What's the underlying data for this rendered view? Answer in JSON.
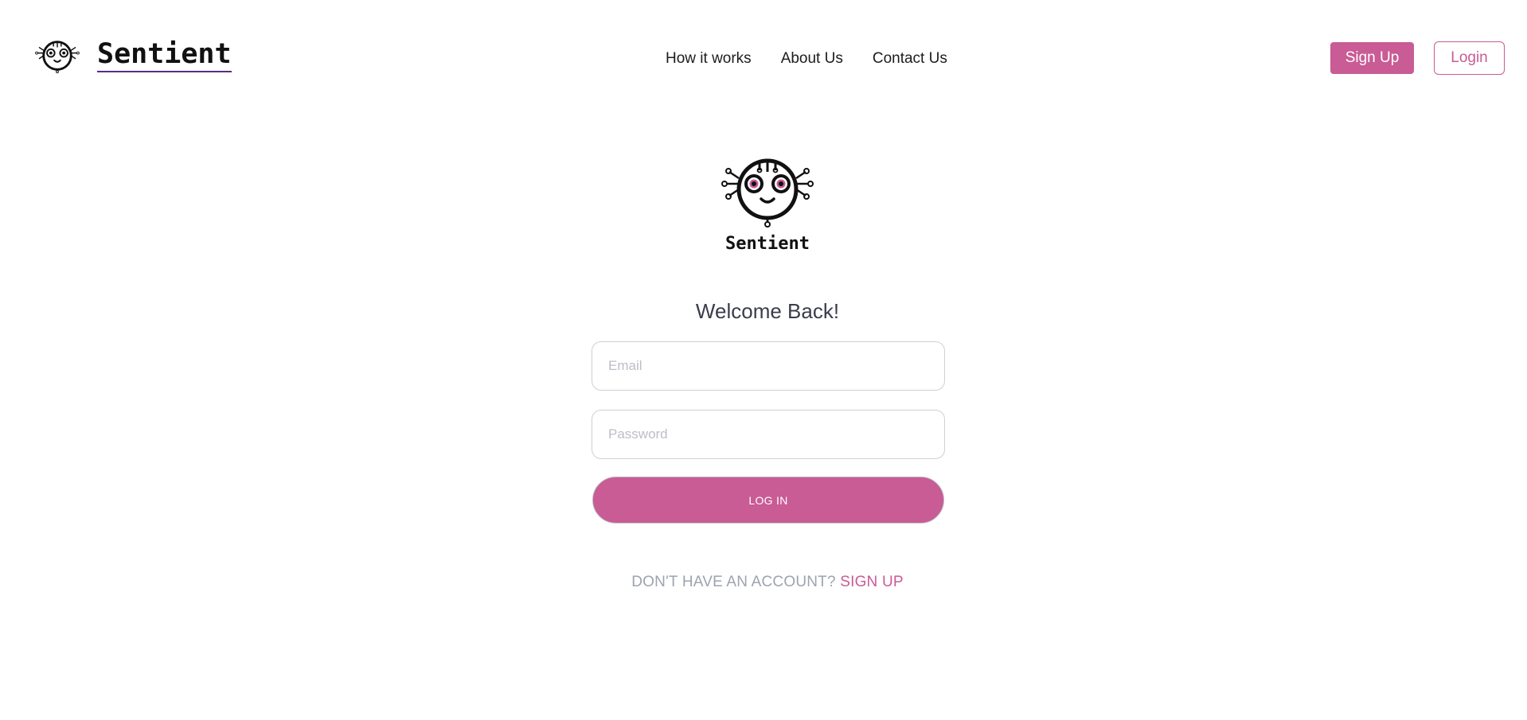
{
  "header": {
    "brand_name": "Sentient",
    "brand_icon": "robot-face-icon",
    "nav": [
      {
        "label": "How it works"
      },
      {
        "label": "About Us"
      },
      {
        "label": "Contact Us"
      }
    ],
    "signup_label": "Sign Up",
    "login_label": "Login"
  },
  "main": {
    "logo_icon": "robot-face-icon",
    "logo_name": "Sentient",
    "welcome": "Welcome Back!",
    "email_placeholder": "Email",
    "email_value": "",
    "password_placeholder": "Password",
    "password_value": "",
    "submit_label": "LOG IN",
    "switch_prompt": "DON'T HAVE AN ACCOUNT?",
    "switch_link": "SIGN UP"
  },
  "colors": {
    "accent": "#c95b95",
    "text_muted": "#9ea3b0",
    "heading": "#3a3d4a",
    "brand_underline": "#5b2a86"
  }
}
